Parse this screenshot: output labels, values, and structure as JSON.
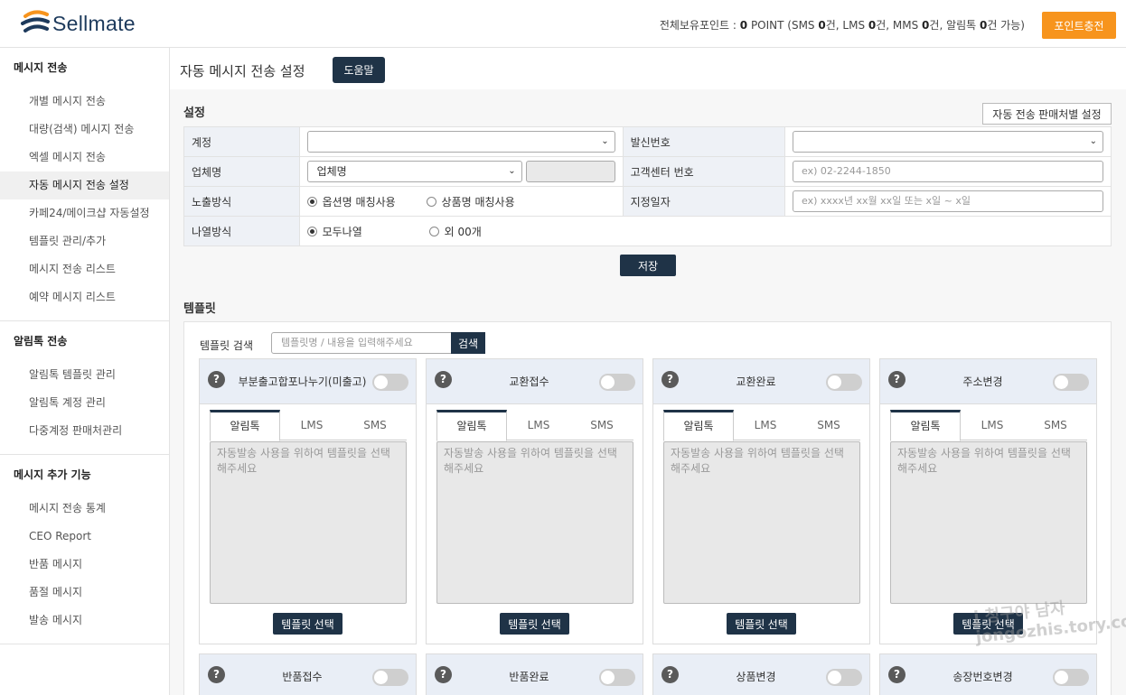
{
  "header": {
    "logo_text": "Sellmate",
    "point_prefix": "전체보유포인트 : ",
    "point_value": "0",
    "point_unit": " POINT (SMS ",
    "sms": "0",
    "lms_label": "건, LMS ",
    "lms": "0",
    "mms_label": "건, MMS ",
    "mms": "0",
    "alim_label": "건, 알림톡 ",
    "alim": "0",
    "suffix": "건 가능)",
    "charge_button": "포인트충전"
  },
  "sidebar": {
    "sections": [
      {
        "title": "메시지 전송",
        "items": [
          "개별 메시지 전송",
          "대량(검색) 메시지 전송",
          "엑셀 메시지 전송",
          "자동 메시지 전송 설정",
          "카페24/메이크샵 자동설정",
          "템플릿 관리/추가",
          "메시지 전송 리스트",
          "예약 메시지 리스트"
        ]
      },
      {
        "title": "알림톡 전송",
        "items": [
          "알림톡 템플릿 관리",
          "알림톡 계정 관리",
          "다중계정 판매처관리"
        ]
      },
      {
        "title": "메시지 추가 기능",
        "items": [
          "메시지 전송 통계",
          "CEO Report",
          "반품 메시지",
          "품절 메시지",
          "발송 메시지"
        ]
      }
    ],
    "active_item": "자동 메시지 전송 설정"
  },
  "page": {
    "title": "자동 메시지 전송 설정",
    "help_button": "도움말"
  },
  "settings": {
    "section_title": "설정",
    "vendor_button": "자동 전송 판매처별 설정",
    "account_label": "계정",
    "account_value": "",
    "sender_label": "발신번호",
    "sender_value": "",
    "company_label": "업체명",
    "company_value": "업체명",
    "company_extra": "",
    "cs_label": "고객센터 번호",
    "cs_placeholder": "ex) 02-2244-1850",
    "exposure_label": "노출방식",
    "exposure_opt1": "옵션명 매칭사용",
    "exposure_opt2": "상품명 매칭사용",
    "date_label": "지정일자",
    "date_placeholder": "ex) xxxx년 xx월 xx일 또는 x일 ~ x일",
    "list_label": "나열방식",
    "list_opt1": "모두나열",
    "list_opt2": "외 00개",
    "save_button": "저장"
  },
  "template": {
    "section_title": "템플릿",
    "search_label": "템플릿 검색",
    "search_placeholder": "템플릿명 / 내용을 입력해주세요",
    "search_button": "검색",
    "tabs": [
      "알림톡",
      "LMS",
      "SMS"
    ],
    "message_placeholder": "자동발송 사용을 위하여 템플릿을 선택해주세요",
    "select_button": "템플릿 선택",
    "cards": [
      {
        "title": "부분출고합포나누기(미출고)"
      },
      {
        "title": "교환접수"
      },
      {
        "title": "교환완료"
      },
      {
        "title": "주소변경"
      }
    ],
    "cards_row2": [
      {
        "title": "반품접수"
      },
      {
        "title": "반품완료"
      },
      {
        "title": "상품변경"
      },
      {
        "title": "송장번호변경"
      }
    ]
  },
  "watermark": "j 청구야 남자 jongozhis.tory.com",
  "colors": {
    "accent": "#f7941d",
    "navy": "#1f3347",
    "label_bg": "#eef1f6"
  }
}
